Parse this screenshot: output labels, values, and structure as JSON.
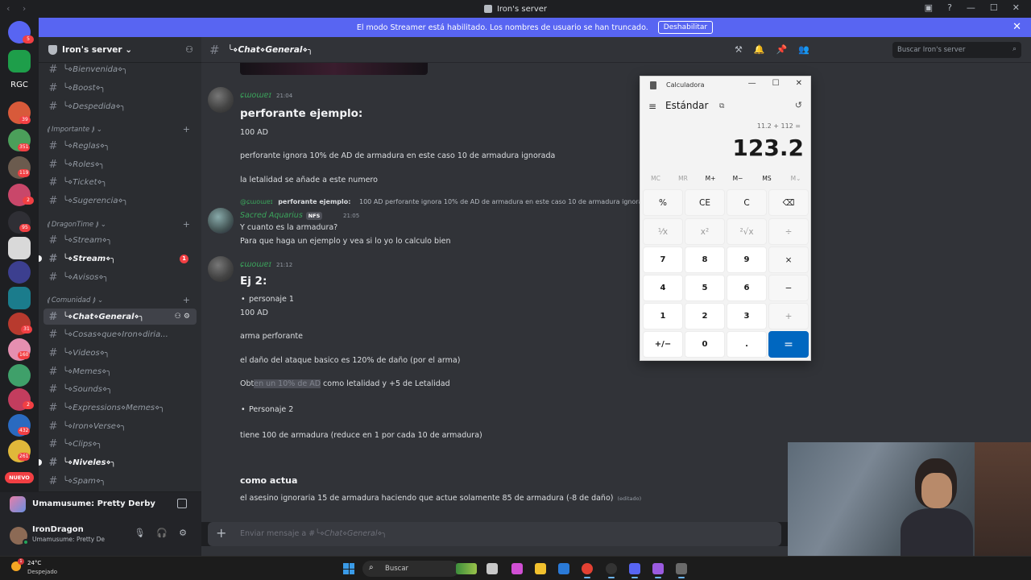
{
  "window": {
    "title": "Iron's server"
  },
  "banner": {
    "text": "El modo Streamer está habilitado. Los nombres de usuario se han truncado.",
    "button": "Deshabilitar",
    "close": "✕"
  },
  "rail": {
    "rgc_label": "RGC",
    "new_label": "NUEVO",
    "badges": [
      "5",
      "39",
      "351",
      "119",
      "2",
      "95",
      "31",
      "160",
      "2",
      "432",
      "261"
    ]
  },
  "sidebar": {
    "server_name": "Iron's server ⌄",
    "channels": [
      {
        "name": "╰⋄Bienvenida⋄╮"
      },
      {
        "name": "╰⋄Boost⋄╮"
      },
      {
        "name": "╰⋄Despedida⋄╮"
      },
      {
        "name": "╰⋄Reglas⋄╮"
      },
      {
        "name": "╰⋄Roles⋄╮"
      },
      {
        "name": "╰⋄Ticket⋄╮"
      },
      {
        "name": "╰⋄Sugerencia⋄╮"
      },
      {
        "name": "╰⋄Stream⋄╮"
      },
      {
        "name": "╰⋄Stream⋄╮",
        "mention": "1"
      },
      {
        "name": "╰⋄Avisos⋄╮"
      },
      {
        "name": "╰⋄Chat⋄General⋄╮"
      },
      {
        "name": "╰⋄Cosas⋄que⋄Iron⋄diria..."
      },
      {
        "name": "╰⋄Videos⋄╮"
      },
      {
        "name": "╰⋄Memes⋄╮"
      },
      {
        "name": "╰⋄Sounds⋄╮"
      },
      {
        "name": "╰⋄Expressions⋄Memes⋄╮"
      },
      {
        "name": "╰⋄Iron⋄Verse⋄╮"
      },
      {
        "name": "╰⋄Clips⋄╮"
      },
      {
        "name": "╰⋄Niveles⋄╮"
      },
      {
        "name": "╰⋄Spam⋄╮"
      }
    ],
    "categories": [
      "⟬ Importante ⟭ ⌄",
      "⟬ DragonTime ⟭ ⌄",
      "⟬ Comunidad ⟭ ⌄"
    ]
  },
  "activity": {
    "title": "Umamusume: Pretty Derby"
  },
  "user": {
    "name": "IronDragon",
    "sub": "Umamusume: Pretty De"
  },
  "chat": {
    "channel": "╰⋄Chat⋄General⋄╮",
    "search_placeholder": "Buscar Iron's server",
    "messages": {
      "m1_author": "ɕɯoɯɐɪ",
      "m1_time": "21:04",
      "m1_heading": "perforante ejemplo:",
      "m1_l1": "100 AD",
      "m1_l2": "perforante ignora 10% de AD de armadura en este caso 10 de armadura ignorada",
      "m1_l3": "la letalidad se añade a este numero",
      "reply_ref_author": "@ɕɯoɯɐɪ",
      "reply_ref_text_bold": "perforante ejemplo:",
      "reply_ref_text": "100 AD  perforante ignora 10% de AD de armadura en este caso 10 de armadura ignorada",
      "m2_author": "Sacred Aquarius",
      "m2_tag": "NFS",
      "m2_time": "21:05",
      "m2_l1": "Y cuanto es la armadura?",
      "m2_l2": "Para que haga un ejemplo y vea si lo yo lo calculo bien",
      "m3_author": "ɕɯoɯɐɪ",
      "m3_time": "21:12",
      "m3_heading": "Ej 2:",
      "m3_b1": "personaje 1",
      "m3_l1": "100 AD",
      "m3_l2": "arma perforante",
      "m3_l3": "el daño del ataque basico es 120% de daño (por el arma)",
      "m3_l4_a": "Obt",
      "m3_l4_hl": "en un 10% de AD",
      "m3_l4_b": " como letalidad y +5 de Letalidad",
      "m3_b2": "Personaje 2",
      "m3_l5": "tiene 100 de armadura (reduce en 1 por cada 10 de armadura)",
      "m3_heading2": "como actua",
      "m3_l6": "el asesino ignoraria 15 de armadura haciendo que actue solamente 85 de armadura (-8 de daño)",
      "m3_edited": "(editado)"
    },
    "input_prefix": "Enviar mensaje a #",
    "input_channel": "╰⋄Chat⋄General⋄╮"
  },
  "calculator": {
    "title": "Calculadora",
    "mode": "Estándar",
    "expression": "11.2 + 112 =",
    "display": "123.2",
    "memory": [
      "MC",
      "MR",
      "M+",
      "M−",
      "MS",
      "M⌄"
    ],
    "keys": [
      [
        "%",
        "CE",
        "C",
        "⌫"
      ],
      [
        "⅟x",
        "x²",
        "²√x",
        "÷"
      ],
      [
        "7",
        "8",
        "9",
        "×"
      ],
      [
        "4",
        "5",
        "6",
        "−"
      ],
      [
        "1",
        "2",
        "3",
        "+"
      ],
      [
        "+/−",
        "0",
        ".",
        "="
      ]
    ]
  },
  "taskbar": {
    "temp": "24°C",
    "condition": "Despejado",
    "search": "Buscar",
    "weather_badge": "1"
  }
}
